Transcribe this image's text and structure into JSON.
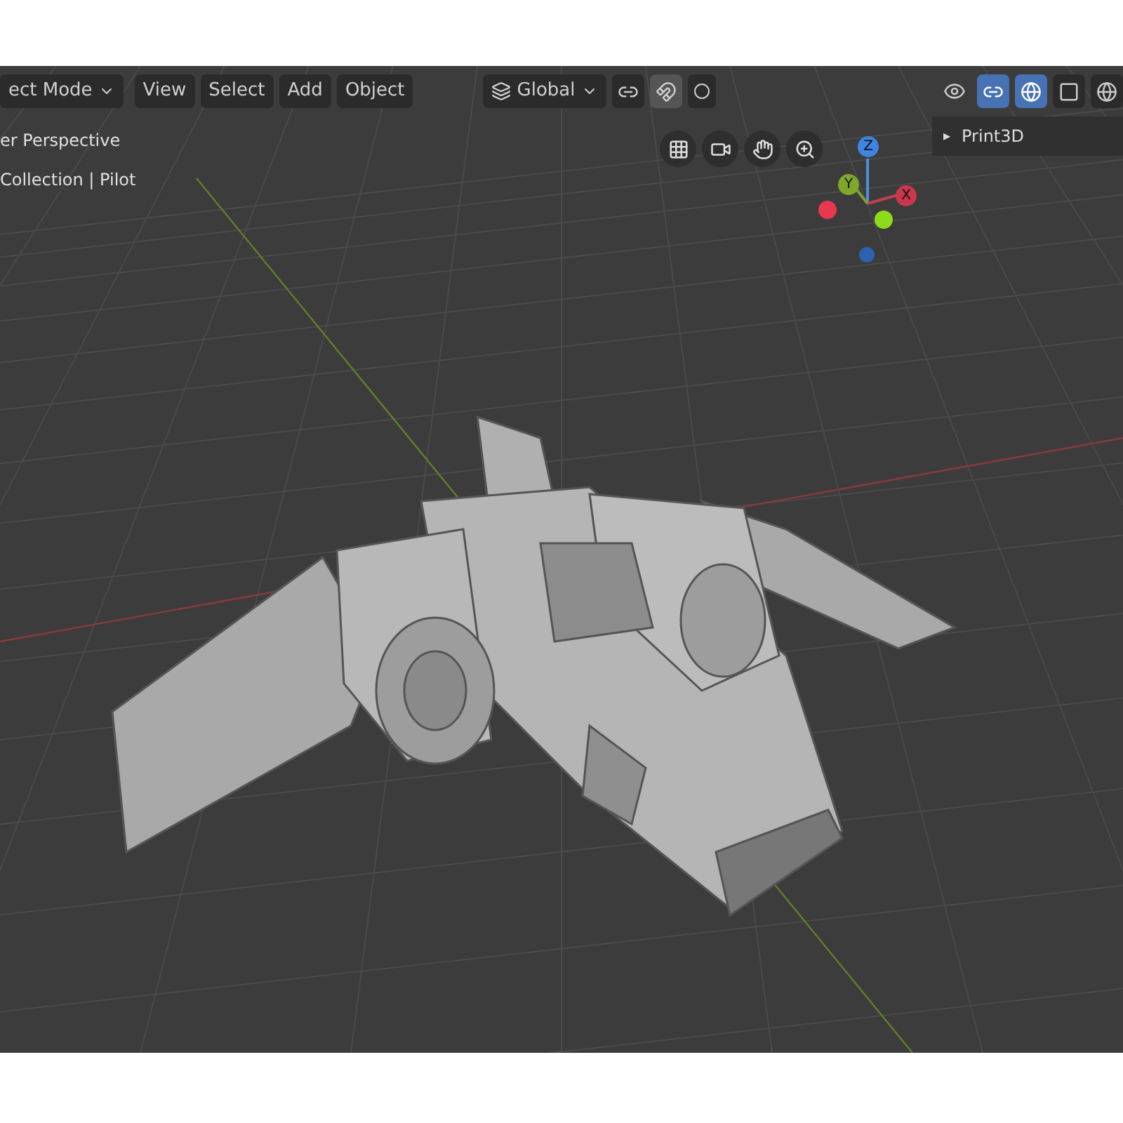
{
  "header": {
    "mode_menu": "ect Mode",
    "menus": [
      "View",
      "Select",
      "Add",
      "Object"
    ],
    "orientation": "Global"
  },
  "viewport_info": [
    "er Perspective",
    "Collection | Pilot"
  ],
  "sidebar_panel": {
    "arrow": "▸",
    "title": "Print3D",
    "expanded": false
  },
  "gizmo": {
    "z": "Z",
    "y": "Y",
    "x": "X"
  }
}
